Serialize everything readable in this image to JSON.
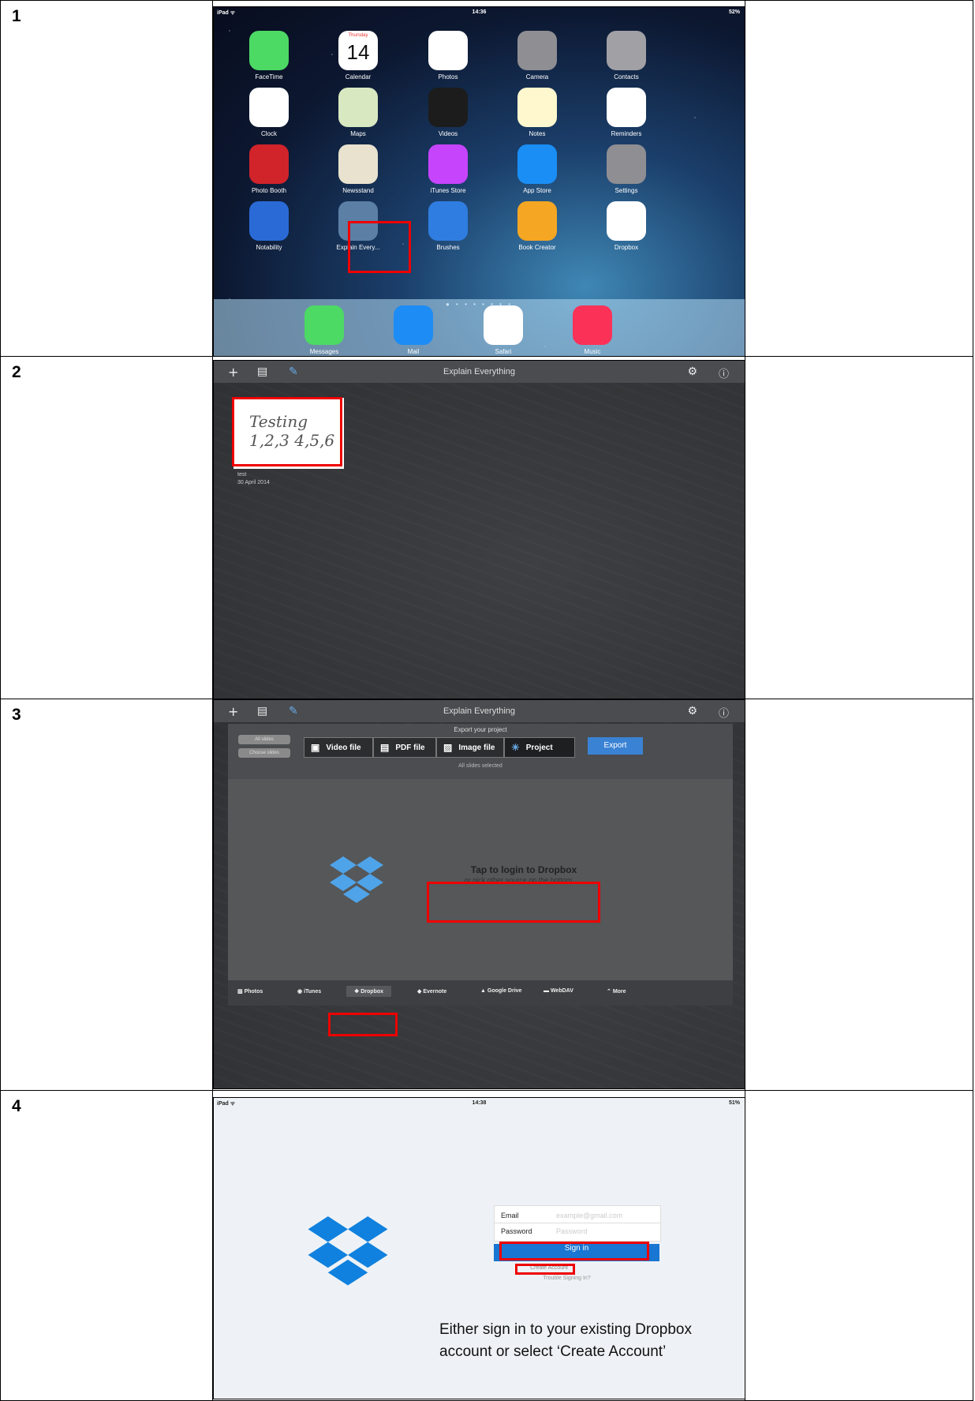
{
  "rows": [
    {
      "number": "1"
    },
    {
      "number": "2"
    },
    {
      "number": "3"
    },
    {
      "number": "4"
    }
  ],
  "panel1": {
    "status_left": "iPad ᯤ",
    "time": "14:36",
    "status_right": "52%",
    "apps": [
      {
        "label": "FaceTime",
        "color": "#4cd964"
      },
      {
        "label": "Calendar",
        "color": "#ffffff",
        "day": "Thursday",
        "date": "14"
      },
      {
        "label": "Photos",
        "color": "#ffffff"
      },
      {
        "label": "Camera",
        "color": "#8e8e93"
      },
      {
        "label": "Contacts",
        "color": "#a0a0a5"
      },
      {
        "label": "Clock",
        "color": "#ffffff"
      },
      {
        "label": "Maps",
        "color": "#d8e8c0"
      },
      {
        "label": "Videos",
        "color": "#1c1c1c"
      },
      {
        "label": "Notes",
        "color": "#fff8cf"
      },
      {
        "label": "Reminders",
        "color": "#ffffff"
      },
      {
        "label": "Photo Booth",
        "color": "#d0232a"
      },
      {
        "label": "Newsstand",
        "color": "#e8e2cf"
      },
      {
        "label": "iTunes Store",
        "color": "#c644fc"
      },
      {
        "label": "App Store",
        "color": "#1a8ef5"
      },
      {
        "label": "Settings",
        "color": "#8e8e93"
      },
      {
        "label": "Notability",
        "color": "#2a6ad6"
      },
      {
        "label": "Explain Every...",
        "color": "#5b7fa5"
      },
      {
        "label": "Brushes",
        "color": "#2f7de0"
      },
      {
        "label": "Book Creator",
        "color": "#f5a623"
      },
      {
        "label": "Dropbox",
        "color": "#ffffff"
      }
    ],
    "page_dots": "● • • • • • • •",
    "dock": [
      {
        "label": "Messages",
        "color": "#4cd964"
      },
      {
        "label": "Mail",
        "color": "#1d8cf5"
      },
      {
        "label": "Safari",
        "color": "#ffffff"
      },
      {
        "label": "Music",
        "color": "#fc3158"
      }
    ]
  },
  "panel2": {
    "title": "Explain Everything",
    "project_name": "test",
    "project_date": "30 April 2014",
    "handwriting": "Testing 1,2,3 4,5,6"
  },
  "panel3": {
    "title": "Explain Everything",
    "export_heading": "Export your project",
    "all_slides": "All slides",
    "choose_slides": "Choose slides",
    "formats": [
      "Video file",
      "PDF file",
      "Image file",
      "Project"
    ],
    "export_button": "Export",
    "selection_status": "All slides selected",
    "login_text": "Tap to login to Dropbox",
    "login_subtext": "or pick other source on the bottom",
    "tabs": [
      "Photos",
      "iTunes",
      "Dropbox",
      "Evernote",
      "Google Drive",
      "WebDAV",
      "More"
    ]
  },
  "panel4": {
    "status_left": "iPad ᯤ",
    "time": "14:38",
    "status_right": "51%",
    "email_label": "Email",
    "email_placeholder": "example@gmail.com",
    "password_label": "Password",
    "password_placeholder": "Password",
    "sign_in": "Sign in",
    "create_account": "Create Account",
    "trouble": "Trouble Signing In?",
    "caption": "Either sign in to your existing Dropbox account or select ‘Create Account’"
  }
}
